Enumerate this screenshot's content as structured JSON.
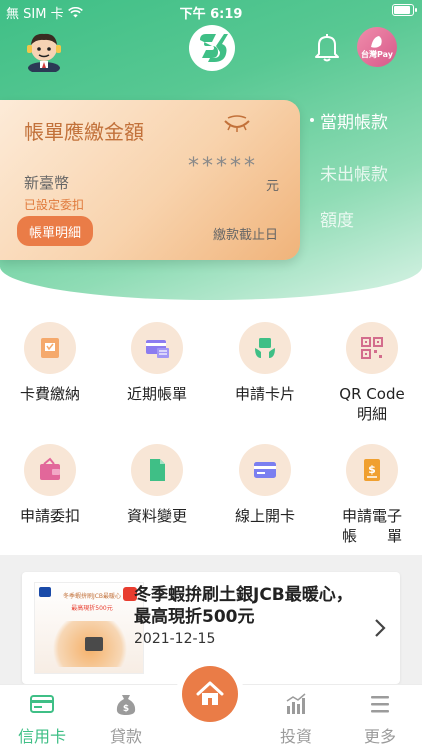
{
  "status_bar": {
    "carrier": "無 SIM 卡",
    "time": "下午 6:19",
    "battery_level": 0.95
  },
  "header": {
    "logo_icon": "ks-logo-icon",
    "bell_icon": "bell-icon",
    "pay_badge": "台灣Pay"
  },
  "bill_card": {
    "title": "帳單應繳金額",
    "currency": "新臺幣",
    "amount_masked": "*****",
    "unit": "元",
    "autopay_status": "已設定委扣",
    "detail_button": "帳單明細",
    "deadline_label": "繳款截止日"
  },
  "side_tabs": [
    {
      "label": "當期帳款",
      "active": true
    },
    {
      "label": "未出帳款",
      "active": false
    },
    {
      "label": "額度",
      "active": false
    }
  ],
  "menu": {
    "row1": [
      {
        "label": "卡費繳納",
        "icon": "payment-icon"
      },
      {
        "label": "近期帳單",
        "icon": "bill-icon"
      },
      {
        "label": "申請卡片",
        "icon": "card-hand-icon"
      },
      {
        "label": "QR Code\n明細",
        "icon": "qr-code-icon"
      }
    ],
    "row2": [
      {
        "label": "申請委扣",
        "icon": "wallet-icon"
      },
      {
        "label": "資料變更",
        "icon": "document-icon"
      },
      {
        "label": "線上開卡",
        "icon": "credit-card-icon"
      },
      {
        "label": "申請電子\n帳　　單",
        "icon": "e-bill-icon"
      }
    ]
  },
  "news": {
    "title": "冬季蝦拚刷土銀JCB最暖心，最高現折500元",
    "date": "2021-12-15",
    "thumb_caption": "冬季蝦拚刷JCB最暖心",
    "thumb_sub": "最高現折500元"
  },
  "tabbar": {
    "items": [
      {
        "label": "信用卡",
        "icon": "credit-card-icon",
        "active": true
      },
      {
        "label": "貸款",
        "icon": "money-bag-icon",
        "active": false
      },
      {
        "label": "投資",
        "icon": "chart-icon",
        "active": false
      },
      {
        "label": "更多",
        "icon": "menu-icon",
        "active": false
      }
    ],
    "home_icon": "home-icon"
  },
  "colors": {
    "brand_green": "#3fbf86",
    "accent_orange": "#ea7c47",
    "icon_bg": "#f8e6d6"
  }
}
